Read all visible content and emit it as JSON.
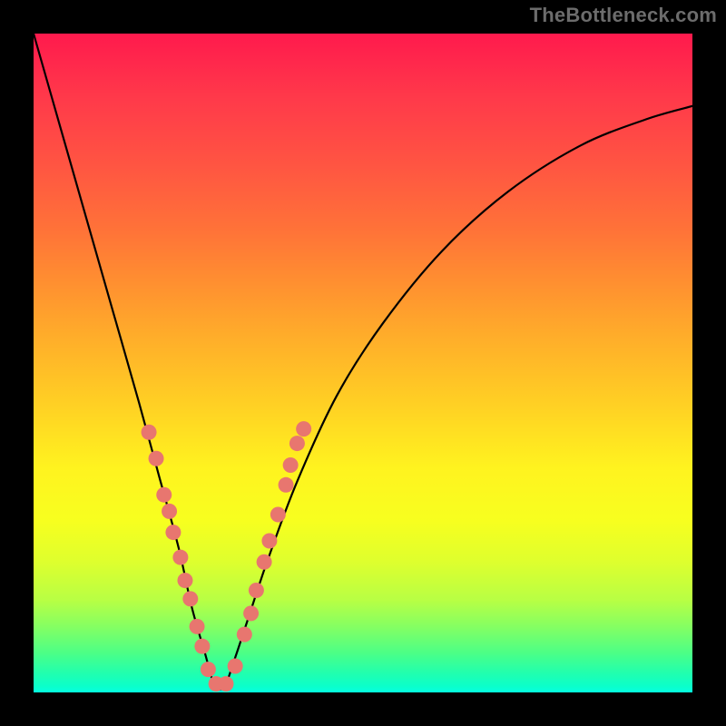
{
  "watermark": "TheBottleneck.com",
  "colors": {
    "background": "#000000",
    "gradient_top": "#ff1a4d",
    "gradient_bottom": "#04ffe0",
    "curve": "#000000",
    "marker": "#e8766f"
  },
  "chart_data": {
    "type": "line",
    "title": "",
    "xlabel": "",
    "ylabel": "",
    "xlim": [
      0,
      1
    ],
    "ylim": [
      0,
      1
    ],
    "note": "No axis ticks or numeric labels are present in the image; x and y are normalized 0–1. The curve shows a sharp V-shaped dip with minimum near x≈0.28, y≈0. Salmon markers cluster along the arms of the V in the lower ~40% of the plot height.",
    "series": [
      {
        "name": "bottleneck-curve",
        "x": [
          0.0,
          0.04,
          0.08,
          0.12,
          0.16,
          0.19,
          0.22,
          0.24,
          0.26,
          0.275,
          0.29,
          0.305,
          0.325,
          0.355,
          0.4,
          0.46,
          0.53,
          0.62,
          0.72,
          0.83,
          0.93,
          1.0
        ],
        "y": [
          1.0,
          0.86,
          0.72,
          0.58,
          0.44,
          0.33,
          0.22,
          0.13,
          0.06,
          0.01,
          0.01,
          0.05,
          0.11,
          0.2,
          0.32,
          0.45,
          0.56,
          0.67,
          0.76,
          0.83,
          0.87,
          0.89
        ]
      }
    ],
    "markers": [
      {
        "x": 0.175,
        "y": 0.395
      },
      {
        "x": 0.186,
        "y": 0.355
      },
      {
        "x": 0.198,
        "y": 0.3
      },
      {
        "x": 0.206,
        "y": 0.275
      },
      {
        "x": 0.212,
        "y": 0.243
      },
      {
        "x": 0.223,
        "y": 0.205
      },
      {
        "x": 0.23,
        "y": 0.17
      },
      {
        "x": 0.238,
        "y": 0.142
      },
      {
        "x": 0.248,
        "y": 0.1
      },
      {
        "x": 0.256,
        "y": 0.07
      },
      {
        "x": 0.265,
        "y": 0.035
      },
      {
        "x": 0.277,
        "y": 0.013
      },
      {
        "x": 0.292,
        "y": 0.013
      },
      {
        "x": 0.306,
        "y": 0.04
      },
      {
        "x": 0.32,
        "y": 0.088
      },
      {
        "x": 0.33,
        "y": 0.12
      },
      {
        "x": 0.338,
        "y": 0.155
      },
      {
        "x": 0.35,
        "y": 0.198
      },
      {
        "x": 0.358,
        "y": 0.23
      },
      {
        "x": 0.371,
        "y": 0.27
      },
      {
        "x": 0.383,
        "y": 0.315
      },
      {
        "x": 0.39,
        "y": 0.345
      },
      {
        "x": 0.4,
        "y": 0.378
      },
      {
        "x": 0.41,
        "y": 0.4
      }
    ]
  }
}
